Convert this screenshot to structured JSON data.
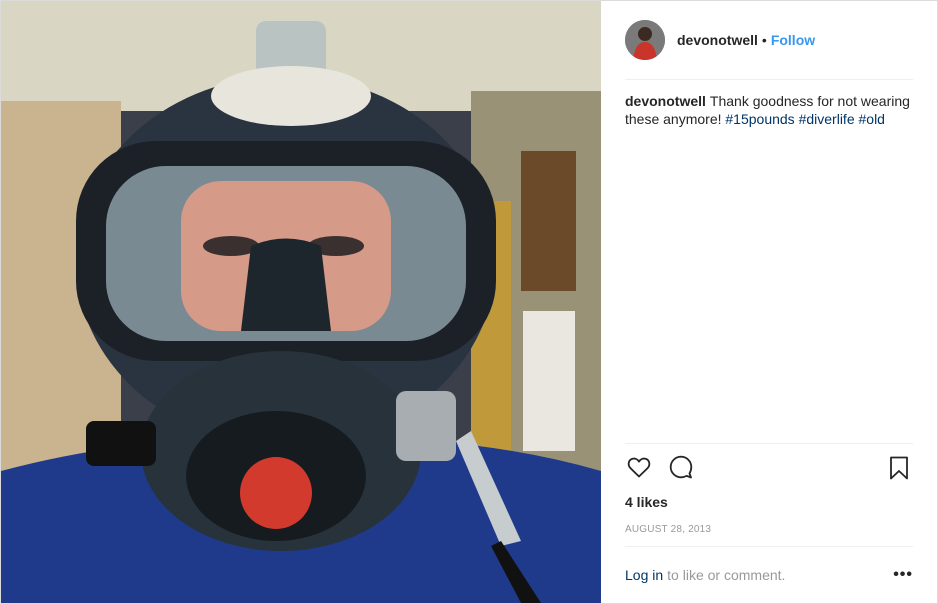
{
  "post": {
    "username": "devonotwell",
    "follow_label": "Follow",
    "separator": "•",
    "caption_text": "Thank goodness for not wearing these anymore!",
    "hashtags": [
      "#15pounds",
      "#diverlife",
      "#old"
    ],
    "likes": "4 likes",
    "date": "AUGUST 28, 2013",
    "login_link": "Log in",
    "login_rest": "to like or comment.",
    "more_label": "•••"
  },
  "icons": {
    "like": "heart-icon",
    "comment": "comment-icon",
    "save": "bookmark-icon",
    "more": "more-options-icon"
  },
  "colors": {
    "link_blue": "#3897f0",
    "hashtag": "#003569",
    "muted": "#999999",
    "text": "#262626"
  }
}
